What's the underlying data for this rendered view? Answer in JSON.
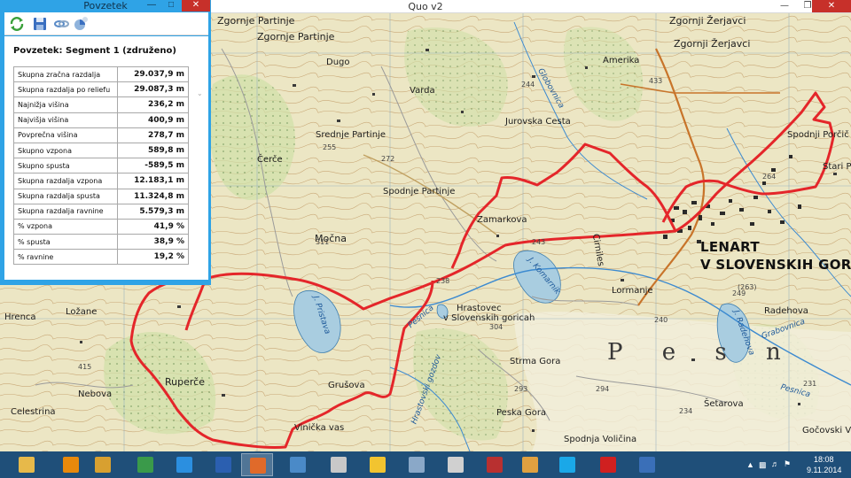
{
  "window": {
    "title": "Quo v2",
    "minimize_icon": "—",
    "restore_icon": "❐",
    "close_icon": "✕"
  },
  "panel": {
    "title": "Povzetek",
    "minimize_icon": "—",
    "restore_icon": "□",
    "close_icon": "✕",
    "heading": "Povzetek: Segment 1 (združeno)",
    "toolbar": [
      "refresh-icon",
      "save-icon",
      "link-icon",
      "chart-icon"
    ],
    "rows": [
      {
        "label": "Skupna zračna razdalja",
        "value": "29.037,9 m"
      },
      {
        "label": "Skupna razdalja po reliefu",
        "value": "29.087,3 m"
      },
      {
        "label": "Najnižja višina",
        "value": "236,2 m"
      },
      {
        "label": "Najvišja višina",
        "value": "400,9 m"
      },
      {
        "label": "Povprečna višina",
        "value": "278,7 m"
      },
      {
        "label": "Skupno vzpona",
        "value": "589,8 m"
      },
      {
        "label": "Skupno spusta",
        "value": "-589,5 m"
      },
      {
        "label": "Skupna razdalja vzpona",
        "value": "12.183,1 m"
      },
      {
        "label": "Skupna razdalja spusta",
        "value": "11.324,8 m"
      },
      {
        "label": "Skupna razdalja ravnine",
        "value": "5.579,3 m"
      },
      {
        "label": "% vzpona",
        "value": "41,9 %"
      },
      {
        "label": "% spusta",
        "value": "38,9 %"
      },
      {
        "label": "% ravnine",
        "value": "19,2 %"
      }
    ]
  },
  "map": {
    "places": [
      {
        "text": "Zgornje Partinje",
        "cls": "lg"
      },
      {
        "text": "Zgornje Partinje",
        "cls": "lg"
      },
      {
        "text": "Zgornji Žerjavci",
        "cls": "lg"
      },
      {
        "text": "Zgornji Žerjavci",
        "cls": "lg"
      },
      {
        "text": "Spodnji Porčič",
        "cls": ""
      },
      {
        "text": "LENART",
        "cls": "town"
      },
      {
        "text": "V SLOVENSKIH GORICAH",
        "cls": "town"
      },
      {
        "text": "Močna",
        "cls": "lg"
      },
      {
        "text": "Spodnje Partinje",
        "cls": ""
      },
      {
        "text": "Zamarkova",
        "cls": ""
      },
      {
        "text": "Hrastovec",
        "cls": ""
      },
      {
        "text": "v Slovenskih goricah",
        "cls": ""
      },
      {
        "text": "Lormanje",
        "cls": ""
      },
      {
        "text": "Radehova",
        "cls": ""
      },
      {
        "text": "Hrenca",
        "cls": ""
      },
      {
        "text": "Ložane",
        "cls": ""
      },
      {
        "text": "Nebova",
        "cls": ""
      },
      {
        "text": "Celestrina",
        "cls": ""
      },
      {
        "text": "Ruperče",
        "cls": "lg"
      },
      {
        "text": "Vinička vas",
        "cls": ""
      },
      {
        "text": "Spodnja Voličina",
        "cls": ""
      },
      {
        "text": "Šetarova",
        "cls": ""
      },
      {
        "text": "Gočovski Vrh",
        "cls": ""
      },
      {
        "text": "Varda",
        "cls": ""
      },
      {
        "text": "Jurovska Cesta",
        "cls": ""
      },
      {
        "text": "Amerika",
        "cls": ""
      },
      {
        "text": "Srednje Partinje",
        "cls": ""
      },
      {
        "text": "Grušova",
        "cls": ""
      },
      {
        "text": "Strma Gora",
        "cls": ""
      },
      {
        "text": "Peska Gora",
        "cls": ""
      },
      {
        "text": "Stari Po",
        "cls": ""
      },
      {
        "text": "Čerče",
        "cls": ""
      },
      {
        "text": "Dugo",
        "cls": ""
      },
      {
        "text": "P e s n",
        "cls": "big"
      },
      {
        "text": "J. Pristava",
        "cls": "water"
      },
      {
        "text": "J. Komarnik",
        "cls": "water"
      },
      {
        "text": "J. Radehova",
        "cls": "water"
      },
      {
        "text": "Pesnica",
        "cls": "water"
      },
      {
        "text": "Pesnica",
        "cls": "water"
      },
      {
        "text": "Globovnica",
        "cls": "water"
      },
      {
        "text": "Grabovnica",
        "cls": "water"
      },
      {
        "text": "Hrastovski gozdov",
        "cls": "water"
      },
      {
        "text": "Cirniles",
        "cls": ""
      },
      {
        "text": "(263)",
        "cls": "elev"
      },
      {
        "text": "243",
        "cls": "elev"
      },
      {
        "text": "238",
        "cls": "elev"
      },
      {
        "text": "304",
        "cls": "elev"
      },
      {
        "text": "240",
        "cls": "elev"
      },
      {
        "text": "249",
        "cls": "elev"
      },
      {
        "text": "234",
        "cls": "elev"
      },
      {
        "text": "231",
        "cls": "elev"
      },
      {
        "text": "244",
        "cls": "elev"
      },
      {
        "text": "311",
        "cls": "elev"
      },
      {
        "text": "272",
        "cls": "elev"
      },
      {
        "text": "255",
        "cls": "elev"
      },
      {
        "text": "294",
        "cls": "elev"
      },
      {
        "text": "293",
        "cls": "elev"
      },
      {
        "text": "264",
        "cls": "elev"
      },
      {
        "text": "415",
        "cls": "elev"
      },
      {
        "text": "433",
        "cls": "elev"
      }
    ]
  },
  "taskbar": {
    "apps": [
      {
        "name": "file-explorer-icon",
        "color": "#e7b94a"
      },
      {
        "name": "outlook-icon",
        "color": "#e8890c"
      },
      {
        "name": "winamp-icon",
        "color": "#d8a030"
      },
      {
        "name": "chrome-icon",
        "color": "#3a9a4a"
      },
      {
        "name": "internet-explorer-icon",
        "color": "#2b8fe0"
      },
      {
        "name": "word-icon",
        "color": "#2b5fb0"
      },
      {
        "name": "quo-icon",
        "color": "#e06a2a"
      },
      {
        "name": "notes-icon",
        "color": "#4a8ac8"
      },
      {
        "name": "calculator-icon",
        "color": "#c8c8c8"
      },
      {
        "name": "google-drive-icon",
        "color": "#f2c430"
      },
      {
        "name": "image-viewer-icon",
        "color": "#8aa8c8"
      },
      {
        "name": "photo-icon",
        "color": "#d0d0d0"
      },
      {
        "name": "spider-icon",
        "color": "#b83030"
      },
      {
        "name": "paint-icon",
        "color": "#e0a040"
      },
      {
        "name": "skype-icon",
        "color": "#1aa8e8"
      },
      {
        "name": "acrobat-icon",
        "color": "#d02020"
      },
      {
        "name": "google-earth-icon",
        "color": "#3a6fb8"
      }
    ],
    "time": "18:08",
    "date": "9.11.2014"
  }
}
